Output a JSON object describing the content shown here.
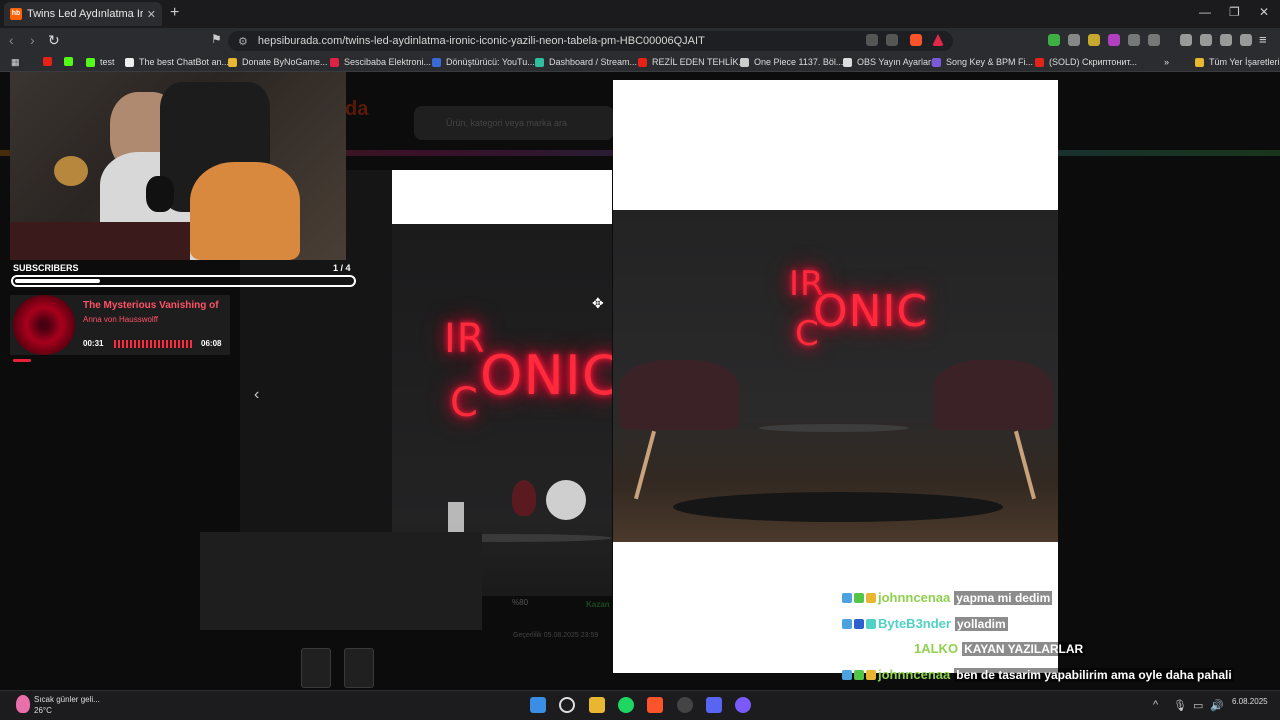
{
  "browser": {
    "tab_title": "Twins Led Aydınlatma Ironic Icon",
    "tab_favicon_text": "hb",
    "url": "hepsiburada.com/twins-led-aydinlatma-ironic-iconic-yazili-neon-tabela-pm-HBC00006QJAIT",
    "bookmarks": [
      "test",
      "The best ChatBot an...",
      "Donate ByNoGame...",
      "Sescibaba Elektroni...",
      "Dönüştürücü: YouTu...",
      "Dashboard / Stream...",
      "REZİL EDEN TEHLİK...",
      "One Piece 1137. Böl...",
      "OBS Yayın Ayarları",
      "Song Key & BPM Fi...",
      "(SOLD) Скриптонит..."
    ],
    "all_bookmarks_label": "Tüm Yer İşaretleri"
  },
  "page": {
    "search_placeholder": "Ürün, kategori veya marka ara",
    "neon_text_top": "IR",
    "neon_text_main": "ONIC",
    "neon_text_c": "C",
    "price_ghost": "%80",
    "date_ghost": "Geçerlilik 05.08.2025 23:59",
    "installment_ghost": "Kazan"
  },
  "overlay": {
    "subscribers_label": "SUBSCRIBERS",
    "subscribers_count": "1 / 4",
    "subscribers_progress": 0.25,
    "song_title": "The Mysterious Vanishing of",
    "song_artist": "Anna von Hausswolff",
    "time_elapsed": "00:31",
    "time_total": "06:08"
  },
  "chat": [
    {
      "user": "johnncenaa",
      "user_color": "#8fd14f",
      "message": "yapma mi dedim"
    },
    {
      "user": "ByteB3nder",
      "user_color": "#4fd1c5",
      "message": "yolladim"
    },
    {
      "user": "1ALKO",
      "user_color": "#8fd14f",
      "message": "KAYAN YAZILARLAR"
    },
    {
      "user": "johnncenaa",
      "user_color": "#8fd14f",
      "message": "ben de tasarim yapabilirim ama oyle daha pahali"
    }
  ],
  "taskbar": {
    "weather_text": "Sıcak günler geli...",
    "temperature": "26°C",
    "clock": "6.08.2025"
  },
  "colors": {
    "neon_red": "#ff2a3c",
    "brand_orange": "#ff6000"
  }
}
